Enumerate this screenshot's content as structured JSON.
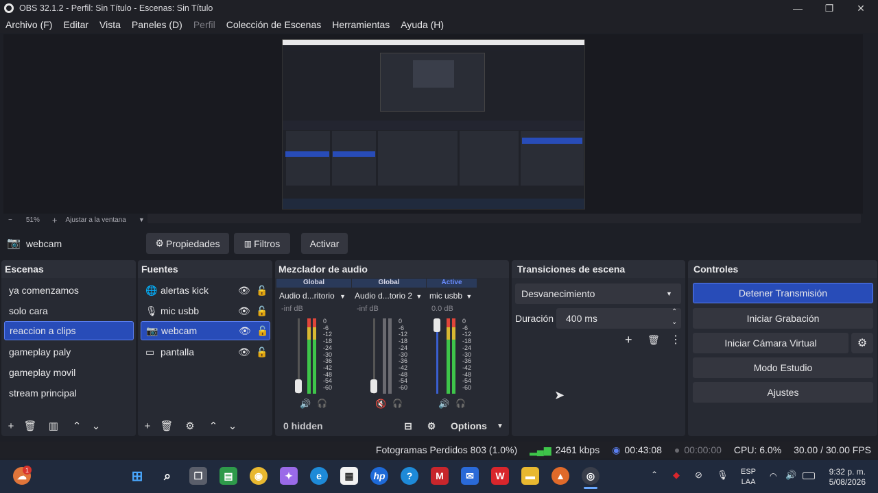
{
  "window": {
    "title": "OBS 32.1.2 - Perfil: Sin Título - Escenas: Sin Título"
  },
  "menu": [
    "Archivo (F)",
    "Editar",
    "Vista",
    "Paneles (D)",
    "Perfil",
    "Colección de Escenas",
    "Herramientas",
    "Ayuda (H)"
  ],
  "zoom": {
    "minus": "−",
    "level": "51%",
    "plus": "+",
    "fit": "Ajustar a la ventana"
  },
  "source_toolbar": {
    "name": "webcam",
    "properties": "Propiedades",
    "filters": "Filtros",
    "activate": "Activar"
  },
  "scenes": {
    "title": "Escenas",
    "items": [
      "ya comenzamos",
      "solo cara",
      "reaccion a clips",
      "gameplay paly",
      "gameplay movil",
      "stream principal"
    ],
    "selected": "reaccion a clips"
  },
  "sources": {
    "title": "Fuentes",
    "items": [
      {
        "name": "alertas kick",
        "icon": "globe-icon"
      },
      {
        "name": "mic usbb",
        "icon": "mic-icon"
      },
      {
        "name": "webcam",
        "icon": "camera-icon"
      },
      {
        "name": "pantalla",
        "icon": "monitor-icon"
      }
    ],
    "selected": "webcam"
  },
  "mixer": {
    "title": "Mezclador de audio",
    "channels": [
      {
        "head": "Global",
        "name": "Audio d...ritorio",
        "db": "-inf dB",
        "muted": false
      },
      {
        "head": "Global",
        "name": "Audio d...torio 2",
        "db": "-inf dB",
        "muted": true
      },
      {
        "head": "Active",
        "name": "mic usbb",
        "db": "0.0 dB",
        "muted": false
      }
    ],
    "scale": [
      "0",
      "-6",
      "-12",
      "-18",
      "-24",
      "-30",
      "-36",
      "-42",
      "-48",
      "-54",
      "-60"
    ],
    "hidden": "0 hidden",
    "options": "Options"
  },
  "transitions": {
    "title": "Transiciones de escena",
    "selected": "Desvanecimiento",
    "duration_label": "Duración",
    "duration": "400 ms"
  },
  "controls": {
    "title": "Controles",
    "stream": "Detener Transmisión",
    "record": "Iniciar Grabación",
    "virtualcam": "Iniciar Cámara Virtual",
    "studio": "Modo Estudio",
    "settings": "Ajustes"
  },
  "status": {
    "dropped": "Fotogramas Perdidos 803 (1.0%)",
    "bitrate": "2461 kbps",
    "stream_time": "00:43:08",
    "rec_time": "00:00:00",
    "cpu": "CPU: 6.0%",
    "fps": "30.00 / 30.00 FPS"
  },
  "taskbar": {
    "lang": "ESP",
    "lang2": "LAA",
    "time": "9:32 p. m.",
    "date": "5/08/2026",
    "badge": "1"
  },
  "colors": {
    "accent": "#284cb8",
    "panel": "#272a33",
    "button": "#34363f"
  }
}
